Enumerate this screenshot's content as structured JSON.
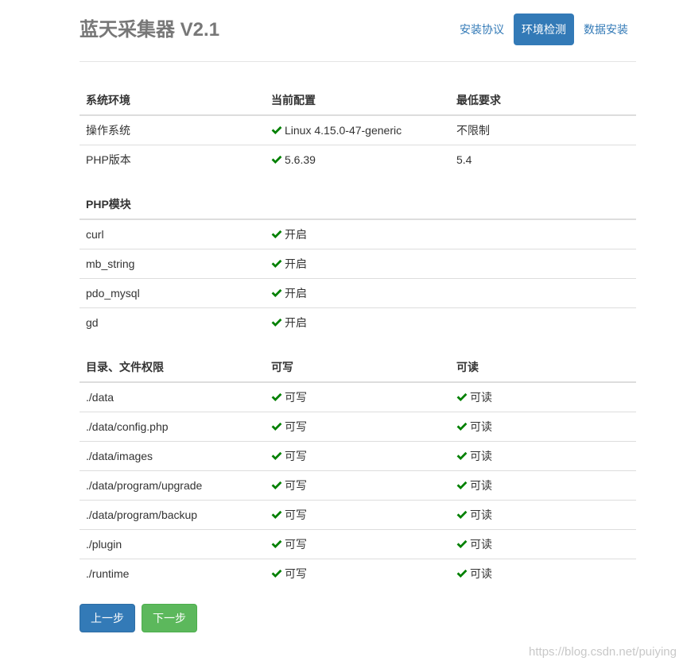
{
  "header": {
    "title": "蓝天采集器 V2.1",
    "nav": [
      {
        "label": "安装协议",
        "active": false
      },
      {
        "label": "环境检测",
        "active": true
      },
      {
        "label": "数据安装",
        "active": false
      }
    ]
  },
  "env_table": {
    "headers": [
      "系统环境",
      "当前配置",
      "最低要求"
    ],
    "rows": [
      {
        "name": "操作系统",
        "current": "Linux 4.15.0-47-generic",
        "required": "不限制"
      },
      {
        "name": "PHP版本",
        "current": "5.6.39",
        "required": "5.4"
      }
    ]
  },
  "module_table": {
    "header": "PHP模块",
    "rows": [
      {
        "name": "curl",
        "status": "开启"
      },
      {
        "name": "mb_string",
        "status": "开启"
      },
      {
        "name": "pdo_mysql",
        "status": "开启"
      },
      {
        "name": "gd",
        "status": "开启"
      }
    ]
  },
  "perm_table": {
    "headers": [
      "目录、文件权限",
      "可写",
      "可读"
    ],
    "rows": [
      {
        "path": "./data",
        "write": "可写",
        "read": "可读"
      },
      {
        "path": "./data/config.php",
        "write": "可写",
        "read": "可读"
      },
      {
        "path": "./data/images",
        "write": "可写",
        "read": "可读"
      },
      {
        "path": "./data/program/upgrade",
        "write": "可写",
        "read": "可读"
      },
      {
        "path": "./data/program/backup",
        "write": "可写",
        "read": "可读"
      },
      {
        "path": "./plugin",
        "write": "可写",
        "read": "可读"
      },
      {
        "path": "./runtime",
        "write": "可写",
        "read": "可读"
      }
    ]
  },
  "actions": {
    "prev_label": "上一步",
    "next_label": "下一步"
  },
  "watermark": "https://blog.csdn.net/puiying",
  "colors": {
    "primary": "#337ab7",
    "success": "#5cb85c",
    "check": "#008000"
  },
  "icons": {
    "check": "check-icon"
  }
}
